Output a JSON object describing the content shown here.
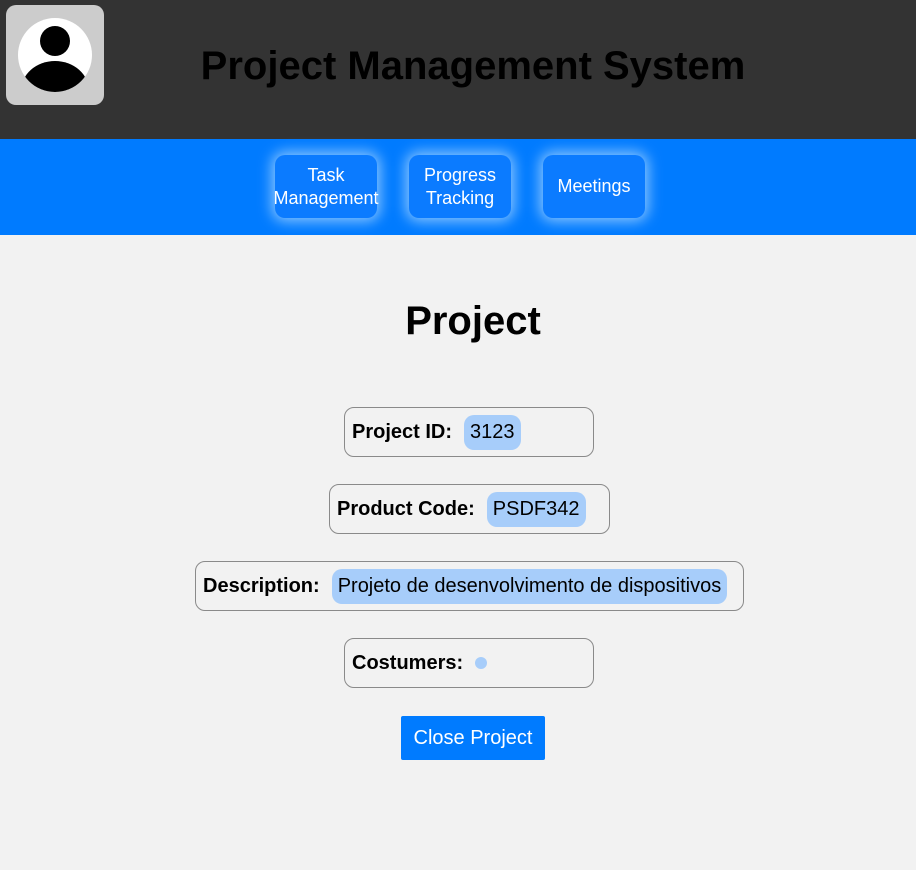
{
  "header": {
    "title": "Project Management System",
    "avatar_icon": "user-avatar-icon"
  },
  "nav": {
    "items": [
      {
        "line1": "Task",
        "line2": "Management"
      },
      {
        "line1": "Progress",
        "line2": "Tracking"
      },
      {
        "line1": "Meetings",
        "line2": ""
      }
    ]
  },
  "page": {
    "title": "Project"
  },
  "fields": {
    "project_id": {
      "label": "Project ID:",
      "value": "3123"
    },
    "product_code": {
      "label": "Product Code:",
      "value": "PSDF342"
    },
    "description": {
      "label": "Description:",
      "value": "Projeto de desenvolvimento de dispositivos"
    },
    "customers": {
      "label": "Costumers:",
      "value": ""
    }
  },
  "actions": {
    "close_label": "Close Project"
  },
  "colors": {
    "header_bg": "#333333",
    "nav_bg": "#007bff",
    "value_chip": "#a7cdfa",
    "page_bg": "#f2f2f2"
  }
}
